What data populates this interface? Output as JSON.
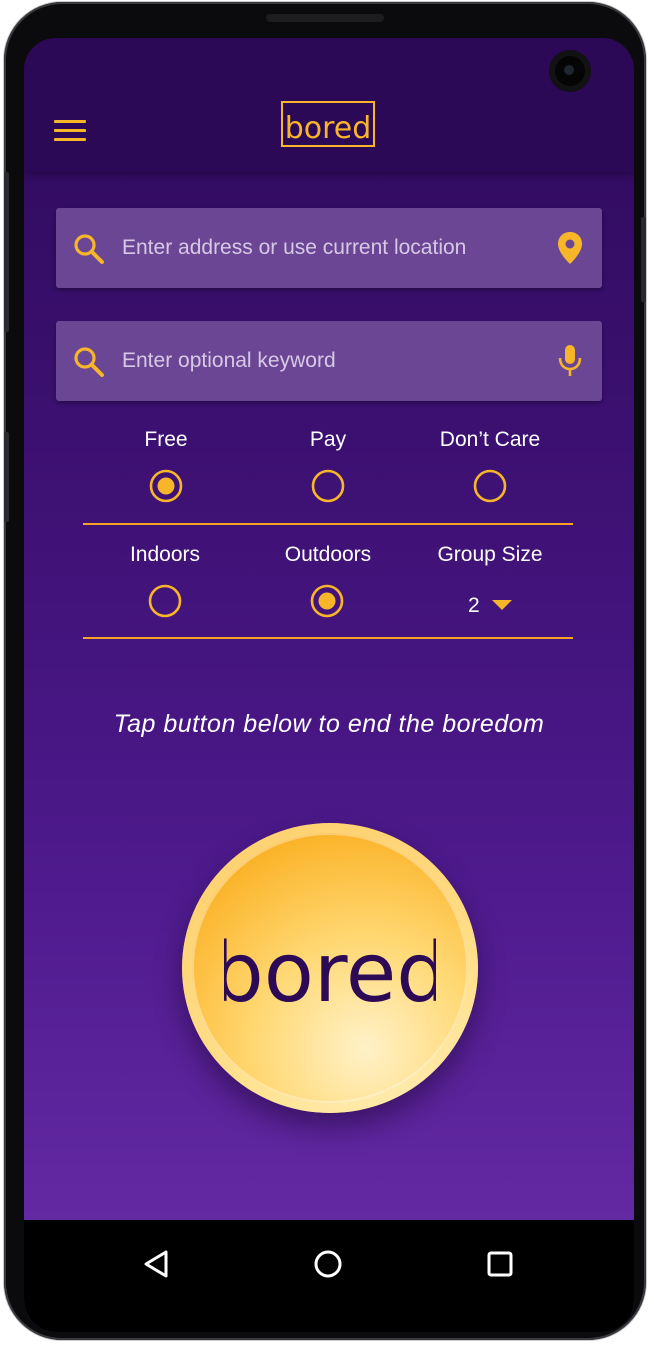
{
  "app": {
    "logo_text": "bored"
  },
  "search": {
    "address_placeholder": "Enter address or use current location",
    "keyword_placeholder": "Enter optional keyword"
  },
  "cost_options": [
    {
      "label": "Free",
      "selected": true
    },
    {
      "label": "Pay",
      "selected": false
    },
    {
      "label": "Don’t Care",
      "selected": false
    }
  ],
  "location_options": [
    {
      "label": "Indoors",
      "selected": false
    },
    {
      "label": "Outdoors",
      "selected": true
    }
  ],
  "group_size": {
    "label": "Group Size",
    "value": "2"
  },
  "tagline": "Tap button below to end the boredom",
  "main_button": {
    "text": "bored"
  },
  "icons": {
    "menu": "hamburger-menu-icon",
    "search": "search-icon",
    "location": "location-pin-icon",
    "mic": "microphone-icon",
    "dropdown": "caret-down-icon",
    "nav_back": "triangle-back-icon",
    "nav_home": "circle-home-icon",
    "nav_recents": "square-recents-icon"
  },
  "colors": {
    "accent": "#f7b52a",
    "appbar": "#2c0956",
    "background_top": "#2e0a5b",
    "background_bottom": "#6a2eaa",
    "field": "#6a4694",
    "button_text": "#2d0a55"
  }
}
